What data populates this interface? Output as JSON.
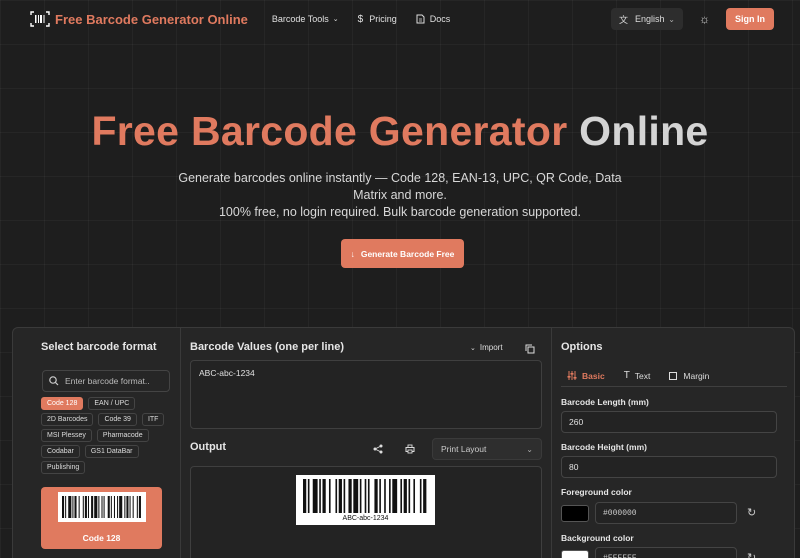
{
  "nav": {
    "brand": "Free Barcode Generator Online",
    "barcode_tools": "Barcode Tools",
    "pricing": "Pricing",
    "docs": "Docs",
    "language": "English",
    "sign_in": "Sign In"
  },
  "hero": {
    "title_accent": "Free Barcode Generator",
    "title_plain": "Online",
    "subtitle_line1": "Generate barcodes online instantly — Code 128, EAN-13, UPC, QR Code, Data Matrix and more.",
    "subtitle_line2": "100% free, no login required. Bulk barcode generation supported.",
    "cta": "Generate Barcode Free"
  },
  "formats": {
    "heading": "Select barcode format",
    "search_placeholder": "Enter barcode format..",
    "chips": [
      "Code 128",
      "EAN / UPC",
      "2D Barcodes",
      "Code 39",
      "ITF",
      "MSI Plessey",
      "Pharmacode",
      "Codabar",
      "GS1 DataBar",
      "Publishing"
    ],
    "active_chip": "Code 128",
    "selected_card": "Code 128",
    "accent_color": "#e07a5f"
  },
  "values": {
    "heading": "Barcode Values (one per line)",
    "import": "Import",
    "text": "ABC-abc-1234"
  },
  "output": {
    "heading": "Output",
    "layout": "Print Layout",
    "preview_text": "ABC-abc-1234"
  },
  "options": {
    "heading": "Options",
    "tabs": [
      "Basic",
      "Text",
      "Margin"
    ],
    "length_label": "Barcode Length (mm)",
    "length_value": "260",
    "height_label": "Barcode Height (mm)",
    "height_value": "80",
    "fg_label": "Foreground color",
    "fg_value": "#000000",
    "bg_label": "Background color",
    "bg_value": "#FFFFFF"
  }
}
